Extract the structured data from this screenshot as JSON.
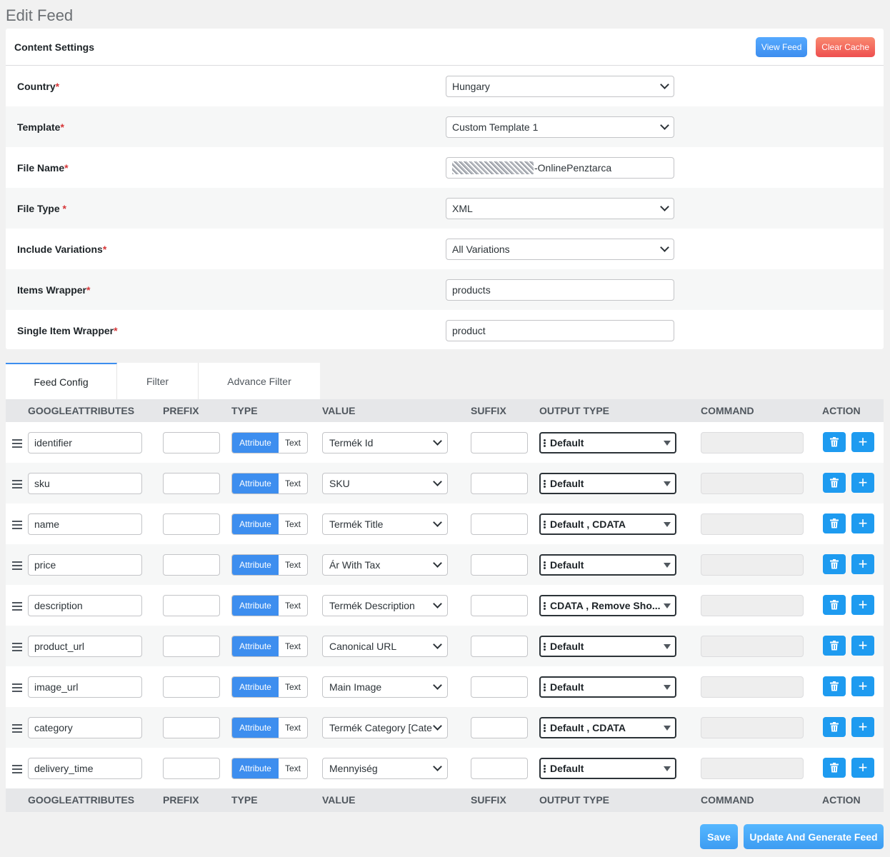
{
  "page": {
    "title": "Edit Feed"
  },
  "content_settings": {
    "title": "Content Settings",
    "view_feed_label": "View Feed",
    "clear_cache_label": "Clear Cache",
    "fields": [
      {
        "label": "Country",
        "req": "*",
        "value": "Hungary",
        "kind": "select"
      },
      {
        "label": "Template",
        "req": "*",
        "value": "Custom Template 1",
        "kind": "select"
      },
      {
        "label": "File Name",
        "req": "*",
        "value": "-OnlinePenztarca",
        "kind": "text"
      },
      {
        "label": "File Type ",
        "req": "*",
        "value": "XML",
        "kind": "select"
      },
      {
        "label": "Include Variations",
        "req": "*",
        "value": "All Variations",
        "kind": "select"
      },
      {
        "label": "Items Wrapper",
        "req": "*",
        "value": "products",
        "kind": "text"
      },
      {
        "label": "Single Item Wrapper",
        "req": "*",
        "value": "product",
        "kind": "text"
      }
    ]
  },
  "tabs": [
    {
      "label": "Feed Config",
      "active": true
    },
    {
      "label": "Filter",
      "active": false
    },
    {
      "label": "Advance Filter",
      "active": false
    }
  ],
  "table": {
    "headers": [
      "GOOGLEATTRIBUTES",
      "PREFIX",
      "TYPE",
      "VALUE",
      "SUFFIX",
      "OUTPUT TYPE",
      "COMMAND",
      "ACTION"
    ],
    "type_on": "Attribute",
    "type_off": "Text",
    "rows": [
      {
        "attr": "identifier",
        "value": "Termék Id",
        "output": "Default"
      },
      {
        "attr": "sku",
        "value": "SKU",
        "output": "Default"
      },
      {
        "attr": "name",
        "value": "Termék Title",
        "output": "Default ,  CDATA"
      },
      {
        "attr": "price",
        "value": "Ár With Tax",
        "output": "Default"
      },
      {
        "attr": "description",
        "value": "Termék Description",
        "output": "CDATA ,  Remove Sho..."
      },
      {
        "attr": "product_url",
        "value": "Canonical URL",
        "output": "Default"
      },
      {
        "attr": "image_url",
        "value": "Main Image",
        "output": "Default"
      },
      {
        "attr": "category",
        "value": "Termék Category [Cate",
        "output": "Default ,  CDATA"
      },
      {
        "attr": "delivery_time",
        "value": "Mennyiség",
        "output": "Default"
      }
    ]
  },
  "footer": {
    "save_label": "Save",
    "update_label": "Update And Generate Feed"
  },
  "colors": {
    "accent": "#3d8eef",
    "danger": "#ee4f4f",
    "action": "#1e9bf0"
  }
}
